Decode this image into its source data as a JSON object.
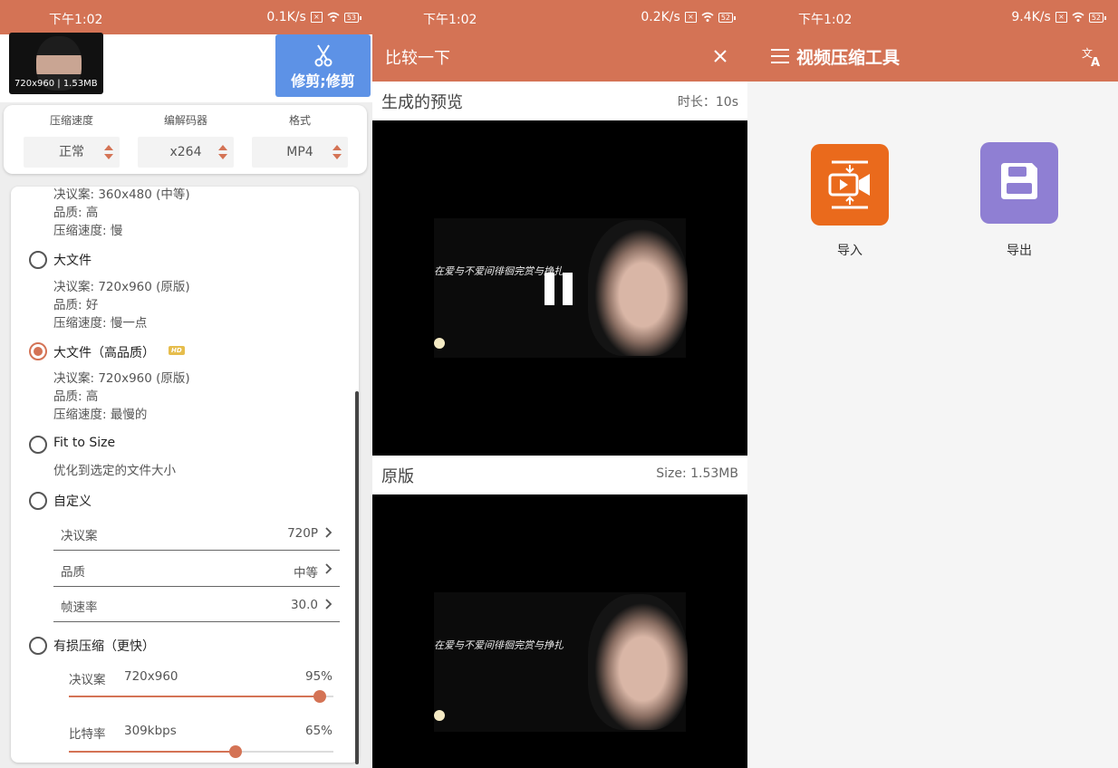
{
  "colors": {
    "accent": "#d47355",
    "trim_button": "#5d92e6",
    "import_tile": "#ea6a1c",
    "export_tile": "#8f7fd3"
  },
  "panel1": {
    "status": {
      "time": "下午1:02",
      "speed": "0.1K/s",
      "battery": "53"
    },
    "thumbnail": {
      "caption": "720x960 | 1.53MB"
    },
    "trim_button": {
      "label": "修剪;修剪",
      "icon": "scissors-icon"
    },
    "options": [
      {
        "header": "压缩速度",
        "value": "正常"
      },
      {
        "header": "编解码器",
        "value": "x264"
      },
      {
        "header": "格式",
        "value": "MP4"
      }
    ],
    "partial_item": {
      "line1": "决议案: 360x480 (中等)",
      "line2": "品质: 高",
      "line3": "压缩速度: 慢"
    },
    "large_file": {
      "label": "大文件",
      "line1": "决议案: 720x960 (原版)",
      "line2": "品质: 好",
      "line3": "压缩速度: 慢一点"
    },
    "large_file_hq": {
      "label": "大文件（高品质）",
      "badge": "HD",
      "line1": "决议案: 720x960 (原版)",
      "line2": "品质: 高",
      "line3": "压缩速度: 最慢的"
    },
    "fit_to_size": {
      "label": "Fit to Size",
      "desc": "优化到选定的文件大小"
    },
    "custom": {
      "label": "自定义",
      "rows": [
        {
          "key": "决议案",
          "value": "720P"
        },
        {
          "key": "品质",
          "value": "中等"
        },
        {
          "key": "帧速率",
          "value": "30.0"
        }
      ]
    },
    "lossy": {
      "label": "有损压缩（更快）",
      "resolution": {
        "key": "决议案",
        "value": "720x960",
        "percent_text": "95%",
        "level": 0.95
      },
      "bitrate": {
        "key": "比特率",
        "value": "309kbps",
        "percent_text": "65%",
        "level": 0.63
      }
    }
  },
  "panel2": {
    "status": {
      "time": "下午1:02",
      "speed": "0.2K/s",
      "battery": "52"
    },
    "title": "比较一下",
    "preview": {
      "label": "生成的预览",
      "duration": "时长：10s"
    },
    "original": {
      "label": "原版",
      "size": "Size: 1.53MB"
    },
    "lyric": "在爱与不爱间徘徊完赏与挣扎"
  },
  "panel3": {
    "status": {
      "time": "下午1:02",
      "speed": "9.4K/s",
      "battery": "52"
    },
    "title": "视频压缩工具",
    "import_label": "导入",
    "export_label": "导出"
  }
}
